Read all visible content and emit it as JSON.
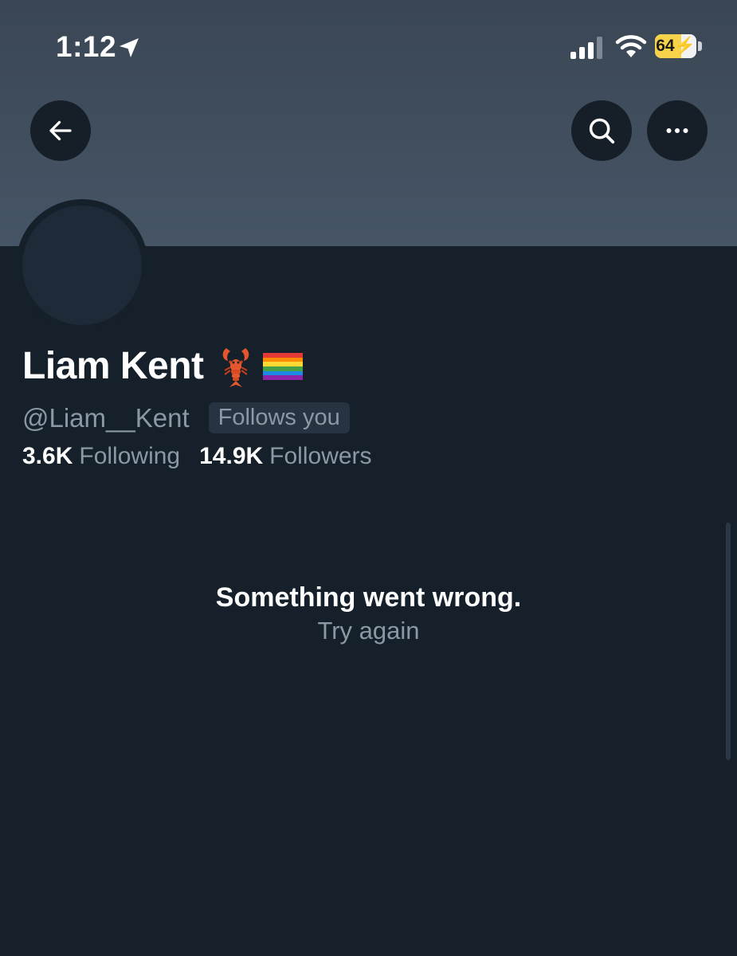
{
  "status_bar": {
    "time": "1:12",
    "battery_level": "64",
    "battery_fraction": 0.64,
    "icons": [
      "location-arrow-icon",
      "cellular-signal-icon",
      "wifi-icon",
      "battery-charging-icon"
    ]
  },
  "header": {
    "back_icon": "arrow-left-icon",
    "search_icon": "search-icon",
    "more_icon": "more-horizontal-icon"
  },
  "profile": {
    "name": "Liam Kent",
    "name_emoji": [
      "lobster-emoji",
      "rainbow-flag-emoji"
    ],
    "handle": "@Liam__Kent",
    "follows_you": "Follows you",
    "following_count": "3.6K",
    "following_label": "Following",
    "followers_count": "14.9K",
    "followers_label": "Followers"
  },
  "error": {
    "title": "Something went wrong.",
    "retry": "Try again"
  },
  "colors": {
    "background": "#15202b",
    "banner": "#415062",
    "secondary_text": "#8b98a5",
    "badge": "#273340"
  }
}
